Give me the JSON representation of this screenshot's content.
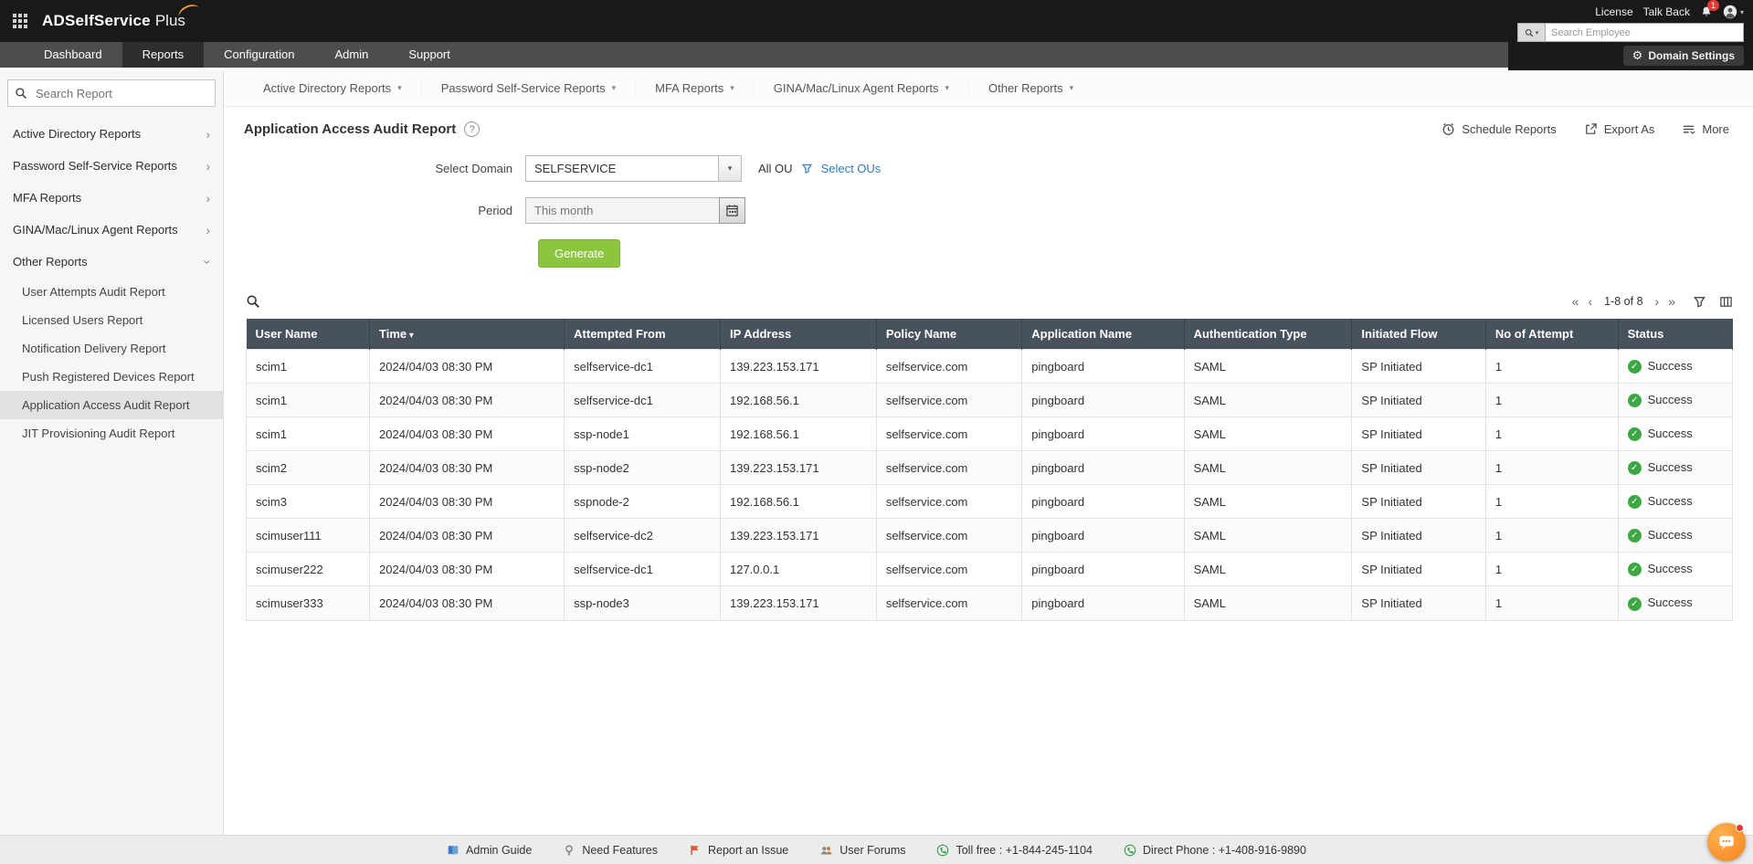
{
  "topbar": {
    "brand_primary": "ADSelfService",
    "brand_suffix": "Plus",
    "license": "License",
    "talkback": "Talk Back",
    "badge_count": "1",
    "employee_search_placeholder": "Search Employee",
    "domain_settings": "Domain Settings"
  },
  "nav_tabs": [
    {
      "label": "Dashboard",
      "active": false
    },
    {
      "label": "Reports",
      "active": true
    },
    {
      "label": "Configuration",
      "active": false
    },
    {
      "label": "Admin",
      "active": false
    },
    {
      "label": "Support",
      "active": false
    }
  ],
  "sidebar": {
    "search_placeholder": "Search Report",
    "groups": [
      {
        "label": "Active Directory Reports",
        "expanded": false
      },
      {
        "label": "Password Self-Service Reports",
        "expanded": false
      },
      {
        "label": "MFA Reports",
        "expanded": false
      },
      {
        "label": "GINA/Mac/Linux Agent Reports",
        "expanded": false
      },
      {
        "label": "Other Reports",
        "expanded": true,
        "children": [
          {
            "label": "User Attempts Audit Report",
            "selected": false
          },
          {
            "label": "Licensed Users Report",
            "selected": false
          },
          {
            "label": "Notification Delivery Report",
            "selected": false
          },
          {
            "label": "Push Registered Devices Report",
            "selected": false
          },
          {
            "label": "Application Access Audit Report",
            "selected": true
          },
          {
            "label": "JIT Provisioning Audit Report",
            "selected": false
          }
        ]
      }
    ]
  },
  "report_menu": [
    "Active Directory Reports",
    "Password Self-Service Reports",
    "MFA Reports",
    "GINA/Mac/Linux Agent Reports",
    "Other Reports"
  ],
  "page": {
    "title": "Application Access Audit Report",
    "actions": {
      "schedule": "Schedule Reports",
      "export": "Export As",
      "more": "More"
    }
  },
  "filters": {
    "domain_label": "Select Domain",
    "domain_value": "SELFSERVICE",
    "all_ou": "All OU",
    "select_ous": "Select OUs",
    "period_label": "Period",
    "period_value": "This month",
    "generate": "Generate"
  },
  "grid": {
    "pagination": "1-8 of 8",
    "sorted_by": "Time",
    "columns": [
      "User Name",
      "Time",
      "Attempted From",
      "IP Address",
      "Policy Name",
      "Application Name",
      "Authentication Type",
      "Initiated Flow",
      "No of Attempt",
      "Status"
    ],
    "rows": [
      [
        "scim1",
        "2024/04/03 08:30 PM",
        "selfservice-dc1",
        "139.223.153.171",
        "selfservice.com",
        "pingboard",
        "SAML",
        "SP Initiated",
        "1",
        "Success"
      ],
      [
        "scim1",
        "2024/04/03 08:30 PM",
        "selfservice-dc1",
        "192.168.56.1",
        "selfservice.com",
        "pingboard",
        "SAML",
        "SP Initiated",
        "1",
        "Success"
      ],
      [
        "scim1",
        "2024/04/03 08:30 PM",
        "ssp-node1",
        "192.168.56.1",
        "selfservice.com",
        "pingboard",
        "SAML",
        "SP Initiated",
        "1",
        "Success"
      ],
      [
        "scim2",
        "2024/04/03 08:30 PM",
        "ssp-node2",
        "139.223.153.171",
        "selfservice.com",
        "pingboard",
        "SAML",
        "SP Initiated",
        "1",
        "Success"
      ],
      [
        "scim3",
        "2024/04/03 08:30 PM",
        "sspnode-2",
        "192.168.56.1",
        "selfservice.com",
        "pingboard",
        "SAML",
        "SP Initiated",
        "1",
        "Success"
      ],
      [
        "scimuser111",
        "2024/04/03 08:30 PM",
        "selfservice-dc2",
        "139.223.153.171",
        "selfservice.com",
        "pingboard",
        "SAML",
        "SP Initiated",
        "1",
        "Success"
      ],
      [
        "scimuser222",
        "2024/04/03 08:30 PM",
        "selfservice-dc1",
        "127.0.0.1",
        "selfservice.com",
        "pingboard",
        "SAML",
        "SP Initiated",
        "1",
        "Success"
      ],
      [
        "scimuser333",
        "2024/04/03 08:30 PM",
        "ssp-node3",
        "139.223.153.171",
        "selfservice.com",
        "pingboard",
        "SAML",
        "SP Initiated",
        "1",
        "Success"
      ]
    ]
  },
  "footer": {
    "links": [
      {
        "icon": "admin-guide-icon",
        "label": "Admin Guide"
      },
      {
        "icon": "need-features-icon",
        "label": "Need Features"
      },
      {
        "icon": "report-issue-icon",
        "label": "Report an Issue"
      },
      {
        "icon": "user-forums-icon",
        "label": "User Forums"
      },
      {
        "icon": "tollfree-phone-icon",
        "label": "Toll free : +1-844-245-1104"
      },
      {
        "icon": "direct-phone-icon",
        "label": "Direct Phone : +1-408-916-9890"
      }
    ]
  },
  "icons": {
    "gear": "⚙",
    "help": "?",
    "chevron_right": "›",
    "caret_down": "▾",
    "sort_desc": "▾",
    "select_arrow": "▾",
    "search_caret": "▾",
    "first_page": "«",
    "prev_page": "‹",
    "next_page": "›",
    "last_page": "»",
    "check": "✓"
  }
}
